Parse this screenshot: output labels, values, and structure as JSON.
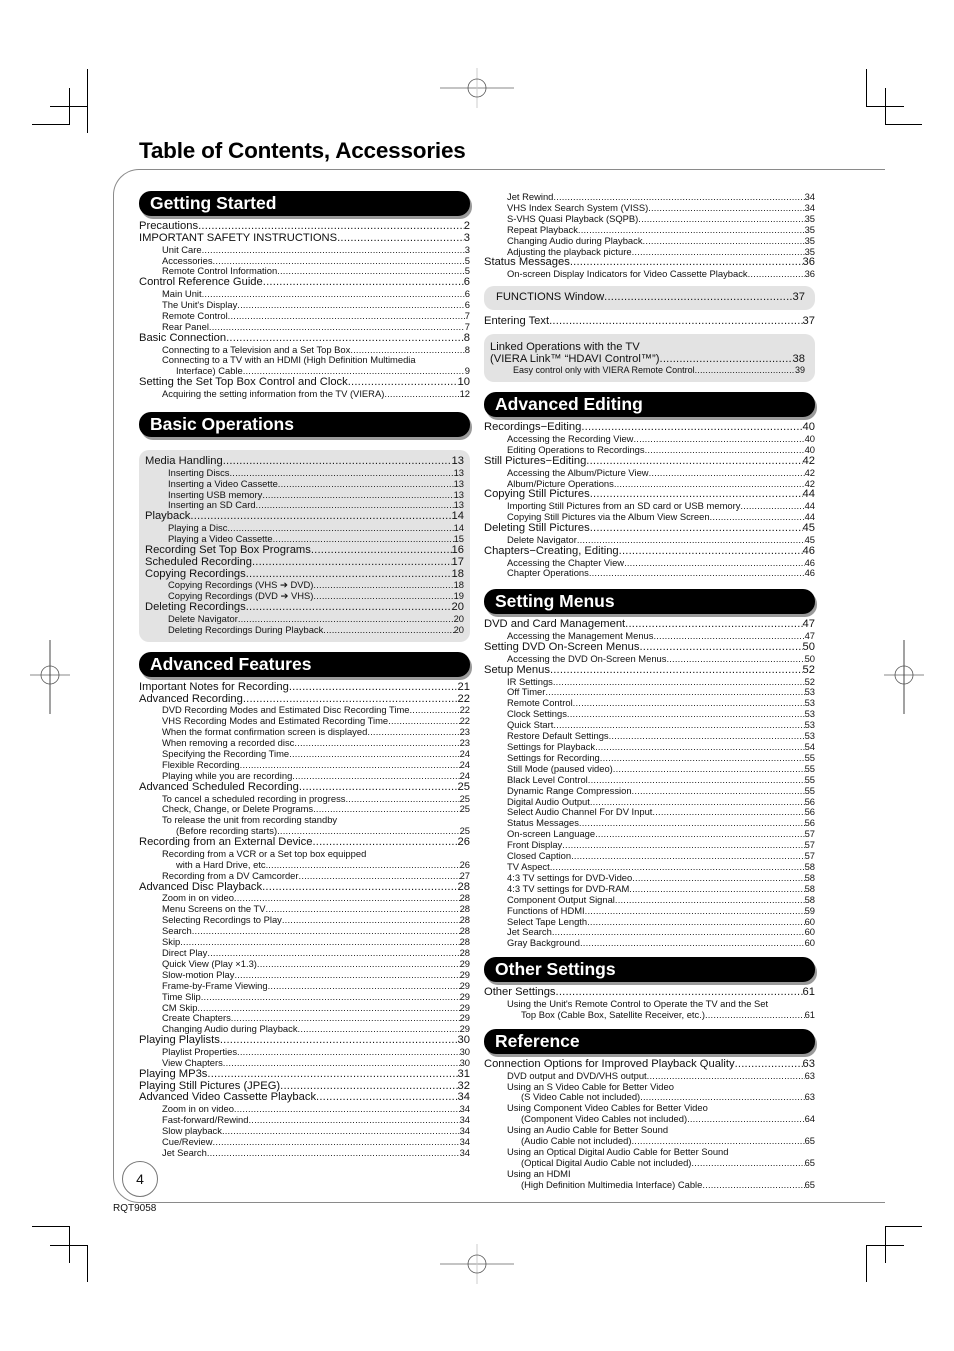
{
  "page": {
    "title": "Table of Contents, Accessories",
    "page_number": "4",
    "doc_id": "RQT9058"
  },
  "sections": {
    "getting_started": {
      "heading": "Getting Started",
      "entries": [
        {
          "level": 1,
          "title": "Precautions",
          "page": "2"
        },
        {
          "level": 1,
          "title": "IMPORTANT SAFETY INSTRUCTIONS",
          "page": "3"
        },
        {
          "level": 2,
          "title": "Unit Care",
          "page": "3"
        },
        {
          "level": 2,
          "title": "Accessories",
          "page": "5"
        },
        {
          "level": 2,
          "title": "Remote Control Information",
          "page": "5"
        },
        {
          "level": 1,
          "title": "Control Reference Guide",
          "page": "6"
        },
        {
          "level": 2,
          "title": "Main Unit",
          "page": "6"
        },
        {
          "level": 2,
          "title": "The Unit's Display",
          "page": "6"
        },
        {
          "level": 2,
          "title": "Remote Control",
          "page": "7"
        },
        {
          "level": 2,
          "title": "Rear Panel",
          "page": "7"
        },
        {
          "level": 1,
          "title": "Basic Connection",
          "page": "8"
        },
        {
          "level": 2,
          "title": "Connecting to a Television and a Set Top Box",
          "page": "8"
        },
        {
          "level": 2,
          "title": "Connecting to a TV with an HDMI (High Definition Multimedia",
          "cont": "Interface) Cable",
          "page": "9"
        },
        {
          "level": 1,
          "title": "Setting the Set Top Box Control and Clock",
          "page": "10"
        },
        {
          "level": 2,
          "title": "Acquiring the setting information from the TV (VIERA)",
          "page": "12"
        }
      ]
    },
    "basic_operations": {
      "heading": "Basic Operations",
      "entries": [
        {
          "level": 1,
          "title": "Media Handling",
          "page": "13"
        },
        {
          "level": 2,
          "title": "Inserting Discs",
          "page": "13"
        },
        {
          "level": 2,
          "title": "Inserting a Video Cassette",
          "page": "13"
        },
        {
          "level": 2,
          "title": "Inserting USB memory",
          "page": "13"
        },
        {
          "level": 2,
          "title": "Inserting an SD Card",
          "page": "13"
        },
        {
          "level": 1,
          "title": "Playback",
          "page": "14"
        },
        {
          "level": 2,
          "title": "Playing a Disc",
          "page": "14"
        },
        {
          "level": 2,
          "title": "Playing a Video Cassette",
          "page": "15"
        },
        {
          "level": 1,
          "title": "Recording Set Top Box Programs",
          "page": "16"
        },
        {
          "level": 1,
          "title": "Scheduled Recording",
          "page": "17"
        },
        {
          "level": 1,
          "title": "Copying Recordings",
          "page": "18"
        },
        {
          "level": 2,
          "title": "Copying Recordings (VHS ➔ DVD)",
          "page": "18"
        },
        {
          "level": 2,
          "title": "Copying Recordings (DVD ➔ VHS)",
          "page": "19"
        },
        {
          "level": 1,
          "title": "Deleting Recordings",
          "page": "20"
        },
        {
          "level": 2,
          "title": "Delete Navigator",
          "page": "20"
        },
        {
          "level": 2,
          "title": "Deleting Recordings During Playback",
          "page": "20"
        }
      ]
    },
    "advanced_features": {
      "heading": "Advanced Features",
      "entries": [
        {
          "level": 1,
          "title": "Important Notes for Recording",
          "page": "21"
        },
        {
          "level": 1,
          "title": "Advanced Recording",
          "page": "22"
        },
        {
          "level": 2,
          "title": "DVD Recording Modes and Estimated Disc Recording Time",
          "page": "22"
        },
        {
          "level": 2,
          "title": "VHS Recording Modes and Estimated Recording Time",
          "page": "22"
        },
        {
          "level": 2,
          "title": "When the format confirmation screen is displayed",
          "page": "23"
        },
        {
          "level": 2,
          "title": "When removing a recorded disc",
          "page": "23"
        },
        {
          "level": 2,
          "title": "Specifying the Recording Time",
          "page": "24"
        },
        {
          "level": 2,
          "title": "Flexible Recording",
          "page": "24"
        },
        {
          "level": 2,
          "title": "Playing while you are recording",
          "page": "24"
        },
        {
          "level": 1,
          "title": "Advanced Scheduled Recording",
          "page": "25"
        },
        {
          "level": 2,
          "title": "To cancel a scheduled recording in progress",
          "page": "25"
        },
        {
          "level": 2,
          "title": "Check, Change, or Delete Programs",
          "page": "25"
        },
        {
          "level": 2,
          "title": "To release the unit from recording standby",
          "cont": "(Before recording starts)",
          "page": "25"
        },
        {
          "level": 1,
          "title": "Recording from an External Device",
          "page": "26"
        },
        {
          "level": 2,
          "title": "Recording from a VCR or a Set top box equipped",
          "cont": "with a Hard Drive, etc.",
          "page": "26"
        },
        {
          "level": 2,
          "title": "Recording from a DV Camcorder",
          "page": "27"
        },
        {
          "level": 1,
          "title": "Advanced Disc Playback",
          "page": "28"
        },
        {
          "level": 2,
          "title": "Zoom in on video",
          "page": "28"
        },
        {
          "level": 2,
          "title": "Menu Screens on the TV",
          "page": "28"
        },
        {
          "level": 2,
          "title": "Selecting Recordings to Play",
          "page": "28"
        },
        {
          "level": 2,
          "title": "Search",
          "page": "28"
        },
        {
          "level": 2,
          "title": "Skip",
          "page": "28"
        },
        {
          "level": 2,
          "title": "Direct Play",
          "page": "28"
        },
        {
          "level": 2,
          "title": "Quick View (Play ×1.3)",
          "page": "29"
        },
        {
          "level": 2,
          "title": "Slow-motion Play",
          "page": "29"
        },
        {
          "level": 2,
          "title": "Frame-by-Frame Viewing",
          "page": "29"
        },
        {
          "level": 2,
          "title": "Time Slip",
          "page": "29"
        },
        {
          "level": 2,
          "title": "CM Skip",
          "page": "29"
        },
        {
          "level": 2,
          "title": "Create Chapters",
          "page": "29"
        },
        {
          "level": 2,
          "title": "Changing Audio during Playback",
          "page": "29"
        },
        {
          "level": 1,
          "title": "Playing Playlists",
          "page": "30"
        },
        {
          "level": 2,
          "title": "Playlist Properties",
          "page": "30"
        },
        {
          "level": 2,
          "title": "View Chapters",
          "page": "30"
        },
        {
          "level": 1,
          "title": "Playing MP3s",
          "page": "31"
        },
        {
          "level": 1,
          "title": "Playing Still Pictures (JPEG)",
          "page": "32"
        },
        {
          "level": 1,
          "title": "Advanced Video Cassette Playback",
          "page": "34"
        },
        {
          "level": 2,
          "title": "Zoom in on video",
          "page": "34"
        },
        {
          "level": 2,
          "title": "Fast-forward/Rewind",
          "page": "34"
        },
        {
          "level": 2,
          "title": "Slow playback",
          "page": "34"
        },
        {
          "level": 2,
          "title": "Cue/Review",
          "page": "34"
        },
        {
          "level": 2,
          "title": "Jet Search",
          "page": "34"
        }
      ]
    },
    "advanced_features_cont": {
      "entries": [
        {
          "level": 2,
          "title": "Jet Rewind",
          "page": "34"
        },
        {
          "level": 2,
          "title": "VHS Index Search System (VISS)",
          "page": "34"
        },
        {
          "level": 2,
          "title": "S-VHS Quasi Playback (SQPB)",
          "page": "35"
        },
        {
          "level": 2,
          "title": "Repeat Playback",
          "page": "35"
        },
        {
          "level": 2,
          "title": "Changing Audio during Playback",
          "page": "35"
        },
        {
          "level": 2,
          "title": "Adjusting the playback picture",
          "page": "35"
        },
        {
          "level": 1,
          "title": "Status Messages",
          "page": "36"
        },
        {
          "level": 2,
          "title": "On-screen Display Indicators for Video Cassette Playback",
          "page": "36"
        }
      ],
      "functions_window": {
        "title": "FUNCTIONS Window",
        "page": "37"
      },
      "entering_text": {
        "title": "Entering Text",
        "page": "37"
      },
      "linked_ops": {
        "line1": "Linked Operations with the TV",
        "line2": "(VIERA Link™ “HDAVI Control™”)",
        "page": "38",
        "sub": {
          "title": "Easy control only with VIERA Remote Control",
          "page": "39"
        }
      }
    },
    "advanced_editing": {
      "heading": "Advanced Editing",
      "entries": [
        {
          "level": 1,
          "title": "Recordings−Editing",
          "page": "40"
        },
        {
          "level": 2,
          "title": "Accessing the Recording View",
          "page": "40"
        },
        {
          "level": 2,
          "title": "Editing Operations to Recordings",
          "page": "40"
        },
        {
          "level": 1,
          "title": "Still Pictures−Editing",
          "page": "42"
        },
        {
          "level": 2,
          "title": "Accessing the Album/Picture View",
          "page": "42"
        },
        {
          "level": 2,
          "title": "Album/Picture Operations",
          "page": "42"
        },
        {
          "level": 1,
          "title": "Copying Still Pictures",
          "page": "44"
        },
        {
          "level": 2,
          "title": "Importing Still Pictures from an SD card or USB memory",
          "page": "44"
        },
        {
          "level": 2,
          "title": "Copying Still Pictures via the Album View Screen",
          "page": "44"
        },
        {
          "level": 1,
          "title": "Deleting Still Pictures",
          "page": "45"
        },
        {
          "level": 2,
          "title": "Delete Navigator",
          "page": "45"
        },
        {
          "level": 1,
          "title": "Chapters−Creating, Editing",
          "page": "46"
        },
        {
          "level": 2,
          "title": "Accessing the Chapter View",
          "page": "46"
        },
        {
          "level": 2,
          "title": "Chapter Operations",
          "page": "46"
        }
      ]
    },
    "setting_menus": {
      "heading": "Setting Menus",
      "entries": [
        {
          "level": 1,
          "title": "DVD and Card Management",
          "page": "47"
        },
        {
          "level": 2,
          "title": "Accessing the Management Menus",
          "page": "47"
        },
        {
          "level": 1,
          "title": "Setting DVD On-Screen Menus",
          "page": "50"
        },
        {
          "level": 2,
          "title": "Accessing the DVD On-Screen Menus",
          "page": "50"
        },
        {
          "level": 1,
          "title": "Setup Menus",
          "page": "52"
        },
        {
          "level": 2,
          "title": "IR Settings",
          "page": "52"
        },
        {
          "level": 2,
          "title": "Off Timer",
          "page": "53"
        },
        {
          "level": 2,
          "title": "Remote Control",
          "page": "53"
        },
        {
          "level": 2,
          "title": "Clock Settings",
          "page": "53"
        },
        {
          "level": 2,
          "title": "Quick Start",
          "page": "53"
        },
        {
          "level": 2,
          "title": "Restore Default Settings",
          "page": "53"
        },
        {
          "level": 2,
          "title": "Settings for Playback",
          "page": "54"
        },
        {
          "level": 2,
          "title": "Settings for Recording",
          "page": "55"
        },
        {
          "level": 2,
          "title": "Still Mode (paused video)",
          "page": "55"
        },
        {
          "level": 2,
          "title": "Black Level Control",
          "page": "55"
        },
        {
          "level": 2,
          "title": "Dynamic Range Compression",
          "page": "55"
        },
        {
          "level": 2,
          "title": "Digital Audio Output",
          "page": "56"
        },
        {
          "level": 2,
          "title": "Select Audio Channel For DV Input",
          "page": "56"
        },
        {
          "level": 2,
          "title": "Status Messages",
          "page": "56"
        },
        {
          "level": 2,
          "title": "On-screen Language",
          "page": "57"
        },
        {
          "level": 2,
          "title": "Front Display",
          "page": "57"
        },
        {
          "level": 2,
          "title": "Closed Caption",
          "page": "57"
        },
        {
          "level": 2,
          "title": "TV Aspect",
          "page": "58"
        },
        {
          "level": 2,
          "title": "4:3 TV settings for DVD-Video",
          "page": "58"
        },
        {
          "level": 2,
          "title": "4:3 TV settings for DVD-RAM",
          "page": "58"
        },
        {
          "level": 2,
          "title": "Component Output Signal",
          "page": "58"
        },
        {
          "level": 2,
          "title": "Functions of HDMI",
          "page": "59"
        },
        {
          "level": 2,
          "title": "Select Tape Length",
          "page": "60"
        },
        {
          "level": 2,
          "title": "Jet Search",
          "page": "60"
        },
        {
          "level": 2,
          "title": "Gray Background",
          "page": "60"
        }
      ]
    },
    "other_settings": {
      "heading": "Other Settings",
      "entries": [
        {
          "level": 1,
          "title": "Other Settings",
          "page": "61"
        },
        {
          "level": 2,
          "title": "Using the Unit's Remote Control to Operate the TV and the Set",
          "cont": "Top Box (Cable Box, Satellite Receiver, etc.)",
          "page": "61"
        }
      ]
    },
    "reference": {
      "heading": "Reference",
      "entries": [
        {
          "level": 1,
          "title": "Connection Options for Improved Playback Quality",
          "page": "63"
        },
        {
          "level": 2,
          "title": "DVD output and DVD/VHS output",
          "page": "63"
        },
        {
          "level": 2,
          "title": "Using an S Video Cable for Better Video",
          "cont": "(S Video Cable not included)",
          "page": "63"
        },
        {
          "level": 2,
          "title": "Using Component Video Cables for Better Video",
          "cont": "(Component Video Cables not included)",
          "page": "64"
        },
        {
          "level": 2,
          "title": "Using an Audio Cable for Better Sound",
          "cont": "(Audio Cable not included)",
          "page": "65"
        },
        {
          "level": 2,
          "title": "Using an Optical Digital Audio Cable for Better Sound",
          "cont": "(Optical Digital Audio Cable not included)",
          "page": "65"
        },
        {
          "level": 2,
          "title": "Using an HDMI",
          "cont": "(High Definition Multimedia Interface) Cable",
          "page": "65"
        }
      ]
    }
  }
}
